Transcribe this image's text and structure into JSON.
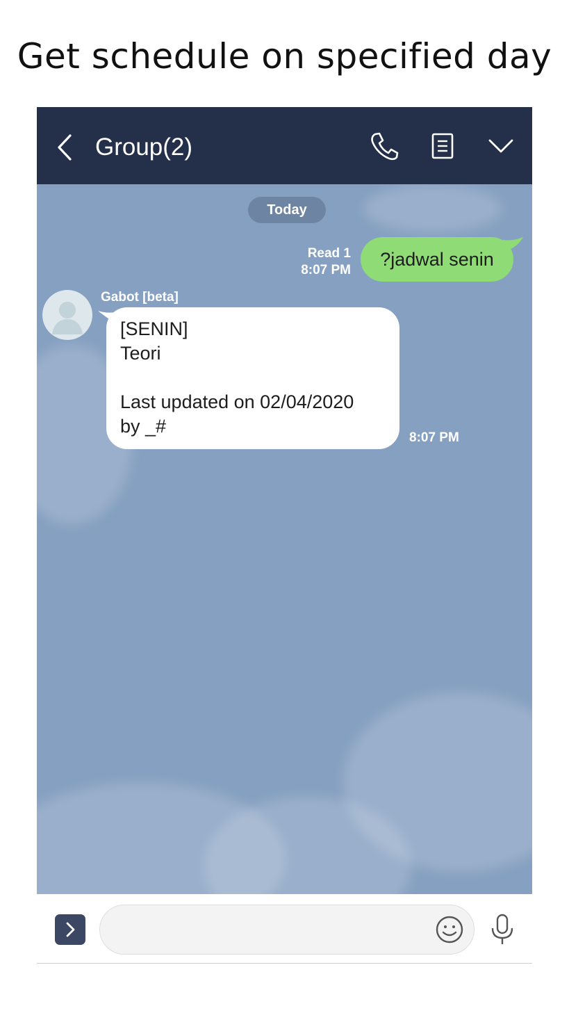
{
  "caption": "Get schedule on specified day",
  "header": {
    "title": "Group(2)",
    "icons": [
      "back-chevron-icon",
      "phone-icon",
      "notes-icon",
      "chevron-down-icon"
    ],
    "background_color": "#243049"
  },
  "chat": {
    "date_divider": "Today",
    "background_color": "#86a0c1",
    "outgoing": {
      "read_status": "Read 1",
      "time": "8:07 PM",
      "text": "?jadwal senin",
      "bubble_color": "#8fdc76"
    },
    "incoming": {
      "sender": "Gabot [beta]",
      "lines": [
        "[SENIN]",
        "Teori",
        "",
        "Last updated on 02/04/2020",
        "by _#"
      ],
      "time": "8:07 PM"
    }
  },
  "input_bar": {
    "placeholder": "",
    "icons": [
      "chevron-right-icon",
      "emoji-icon",
      "microphone-icon"
    ]
  }
}
